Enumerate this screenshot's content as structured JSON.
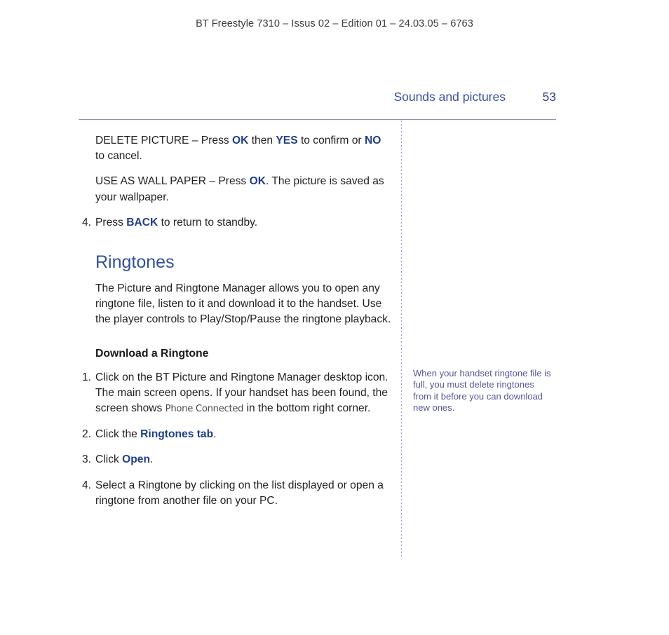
{
  "document": {
    "running_head": "BT Freestyle 7310 – Issus 02 – Edition 01 – 24.03.05 – 6763",
    "section_title": "Sounds and pictures",
    "page_number": "53",
    "colors": {
      "heading_blue": "#32519c",
      "keyword_blue": "#1f3e8c",
      "folio_blue": "#3b4f9e",
      "note_purple": "#55559a",
      "rule_lavender": "#8d8dbe",
      "body_text": "#231f20"
    }
  },
  "content": {
    "delete_picture": {
      "label": "DELETE PICTURE",
      "dash": " – ",
      "press": "Press ",
      "key_ok": "OK",
      "then": " then ",
      "key_yes": "YES",
      "confirm": " to confirm or ",
      "key_no": "NO",
      "cancel": " to cancel."
    },
    "use_as_wallpaper": {
      "label": "USE AS WALL PAPER",
      "dash": " – ",
      "press": "Press ",
      "key_ok": "OK",
      "rest": ". The picture is saved as your wallpaper."
    },
    "step_prev_4": {
      "marker": "4.",
      "press": "Press ",
      "key_back": "BACK",
      "rest": " to return to standby."
    },
    "ringtones_heading": "Ringtones",
    "ringtones_intro": "The Picture and Ringtone Manager allows you to open any ringtone file, listen to it and download it to the handset. Use the player controls to Play/Stop/Pause the ringtone playback.",
    "download_subheading": "Download a Ringtone",
    "steps": {
      "one": {
        "marker": "1.",
        "text_a": "Click on the BT Picture and Ringtone Manager desktop icon. The main screen opens. If your handset has been found, the screen shows ",
        "screen_label": "Phone Connected",
        "text_b": " in the bottom right corner."
      },
      "two": {
        "marker": "2.",
        "text_a": "Click the ",
        "keyword": "Ringtones tab",
        "text_b": "."
      },
      "three": {
        "marker": "3.",
        "text_a": "Click ",
        "keyword": "Open",
        "text_b": "."
      },
      "four": {
        "marker": "4.",
        "text": "Select a Ringtone by clicking on the list displayed or open a ringtone from another file on your PC."
      }
    },
    "side_note": "When your handset ringtone file is full, you must delete ringtones from it before you can download new ones."
  }
}
